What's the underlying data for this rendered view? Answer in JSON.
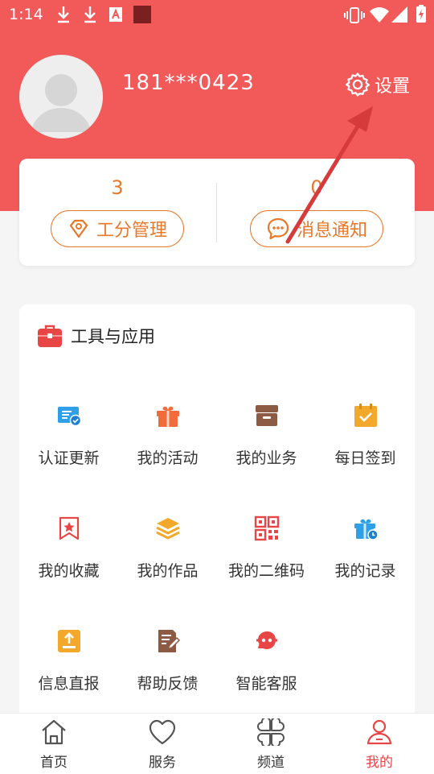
{
  "status_bar": {
    "time": "1:14"
  },
  "profile": {
    "phone": "181***0423",
    "settings_label": "设置"
  },
  "stats": [
    {
      "value": "3",
      "label": "工分管理",
      "icon": "diamond-icon"
    },
    {
      "value": "0",
      "label": "消息通知",
      "icon": "chat-bubble-icon"
    }
  ],
  "tools": {
    "title": "工具与应用",
    "items": [
      {
        "label": "认证更新",
        "icon": "certificate-icon"
      },
      {
        "label": "我的活动",
        "icon": "gift-icon"
      },
      {
        "label": "我的业务",
        "icon": "archive-box-icon"
      },
      {
        "label": "每日签到",
        "icon": "calendar-check-icon"
      },
      {
        "label": "我的收藏",
        "icon": "bookmark-star-icon"
      },
      {
        "label": "我的作品",
        "icon": "layers-icon"
      },
      {
        "label": "我的二维码",
        "icon": "qr-code-icon"
      },
      {
        "label": "我的记录",
        "icon": "gift-clock-icon"
      },
      {
        "label": "信息直报",
        "icon": "upload-icon"
      },
      {
        "label": "帮助反馈",
        "icon": "edit-document-icon"
      },
      {
        "label": "智能客服",
        "icon": "robot-icon"
      }
    ]
  },
  "tabbar": [
    {
      "label": "首页",
      "icon": "home-icon",
      "active": false
    },
    {
      "label": "服务",
      "icon": "heart-icon",
      "active": false
    },
    {
      "label": "频道",
      "icon": "channel-grid-icon",
      "active": false
    },
    {
      "label": "我的",
      "icon": "person-icon",
      "active": true
    }
  ],
  "colors": {
    "header": "#f25a5a",
    "accent_orange": "#e8782a",
    "active_red": "#e84545"
  }
}
